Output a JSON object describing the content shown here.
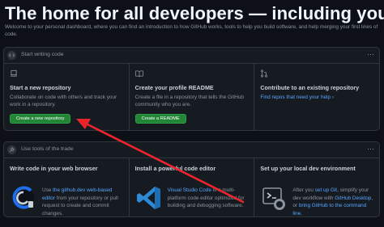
{
  "hero": {
    "title": "The home for all developers — including you.",
    "subtitle": "Welcome to your personal dashboard, where you can find an introduction to how GitHub works, tools to help you build software, and help merging your first lines of code."
  },
  "start_panel": {
    "heading": "Start writing code",
    "cards": [
      {
        "title": "Start a new repository",
        "description": "Collaborate on code with others and track your work in a repository.",
        "button_label": "Create a new repository"
      },
      {
        "title": "Create your profile README",
        "description": "Create a file in a repository that tells the GitHub community who you are.",
        "button_label": "Create a README"
      },
      {
        "title": "Contribute to an existing repository",
        "link_label": "Find repos that need your help",
        "link_suffix": "›"
      }
    ]
  },
  "tools_panel": {
    "heading": "Use tools of the trade",
    "cards": [
      {
        "title": "Write code in your web browser",
        "desc_pre": "Use ",
        "link_label": "the github.dev web-based editor",
        "desc_post": " from your repository or pull request to create and commit changes."
      },
      {
        "title": "Install a powerful code editor",
        "link_label": "Visual Studio Code",
        "desc_post": " is a multi-platform code editor optimized for building and debugging software."
      },
      {
        "title": "Set up your local dev environment",
        "desc_pre": "After you ",
        "link_label": "set up Git",
        "desc_mid": ", simplify your dev workflow with ",
        "link2_label": "GitHub Desktop",
        "desc_mid2": ", or ",
        "link3_label": "bring GitHub to the command line",
        "desc_post": "."
      }
    ]
  },
  "menu_glyph": "⋯",
  "colors": {
    "background": "#0d1117",
    "panel": "#161b22",
    "border": "#30363d",
    "primary_button": "#238636",
    "link": "#58a6ff",
    "annotation_arrow": "#e8252a",
    "vscode_blue": "#2f8ad6"
  },
  "icons": [
    "code-icon",
    "repo-icon",
    "book-icon",
    "git-pull-request-icon",
    "github-dev-logo-icon",
    "vscode-logo-icon",
    "terminal-desktop-icon",
    "kebab-menu-icon",
    "annotation-arrow"
  ]
}
